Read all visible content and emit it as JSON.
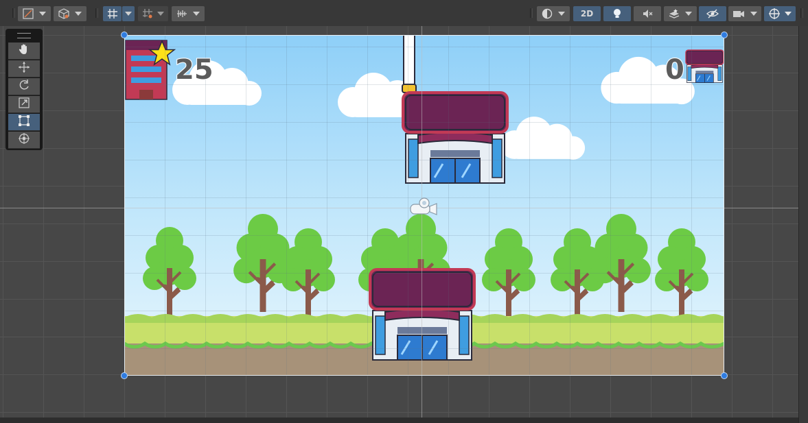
{
  "toolbar": {
    "mode_2d_label": "2D",
    "left_tools": [
      "draw-mode-icon",
      "shading-cube-icon",
      "grid-snap-icon",
      "increment-snap-icon",
      "ruler-snap-icon"
    ],
    "right_tools": [
      "render-sphere-icon",
      "lighting-bulb-icon",
      "audio-mute-icon",
      "effects-layers-icon",
      "hidden-visibility-icon",
      "camera-icon",
      "gizmos-icon"
    ]
  },
  "tools": {
    "items": [
      "hand-tool",
      "move-tool",
      "rotate-tool",
      "scale-tool",
      "rect-tool",
      "transform-tool"
    ],
    "active": "rect-tool"
  },
  "game": {
    "score": "25",
    "floors": "0"
  },
  "colors": {
    "accent_blue": "#46607c",
    "handle_blue": "#2f7ce0",
    "roof_purple": "#6b2454",
    "roof_red": "#c23a55",
    "tree_green": "#6ccb45",
    "trunk_brown": "#8b5a4a",
    "grass": "#c8e06a",
    "dirt": "#a79279"
  }
}
